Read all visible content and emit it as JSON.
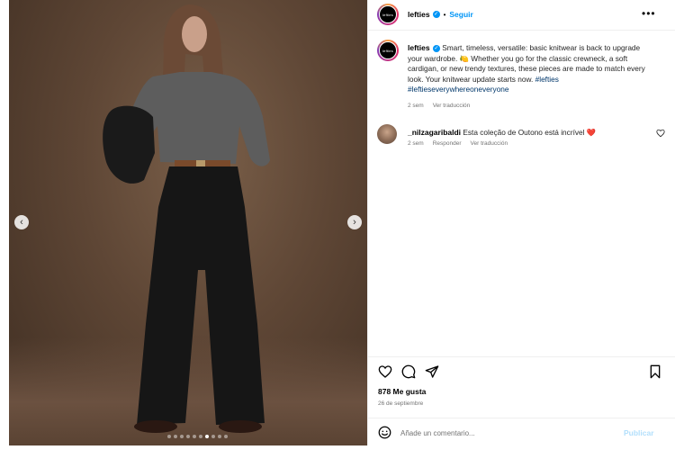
{
  "post": {
    "username": "lefties",
    "follow_label": "Seguir",
    "separator": "•",
    "avatar_text": "lefties"
  },
  "caption": {
    "username": "lefties",
    "text": "Smart, timeless, versatile: basic knitwear is back to upgrade your wardrobe. 🍋 Whether you go for the classic crewneck, a soft cardigan, or new trendy textures, these pieces are made to match every look. Your knitwear update starts now.",
    "hashtags": "#lefties #leftieseverywhereoneveryone",
    "time": "2 sem",
    "translate_label": "Ver traducción"
  },
  "comments": [
    {
      "username": "_nilzagaribaldi",
      "text": "Esta coleção de Outono está incrível",
      "emoji": "❤️",
      "time": "2 sem",
      "reply_label": "Responder",
      "translate_label": "Ver traducción"
    }
  ],
  "carousel": {
    "dot_count": 10,
    "active_dot": 6
  },
  "engagement": {
    "likes": "878 Me gusta",
    "date": "26 de septiembre"
  },
  "composer": {
    "placeholder": "Añade un comentario...",
    "publish_label": "Publicar"
  },
  "icons": [
    "chevron-left-icon",
    "chevron-right-icon",
    "verified-icon",
    "more-icon",
    "heart-icon",
    "comment-icon",
    "share-icon",
    "bookmark-icon",
    "emoji-icon"
  ],
  "colors": {
    "accent": "#0095f6",
    "hashtag": "#00376b",
    "muted": "#737373",
    "heart": "#ed4956",
    "publish_disabled": "#b2dffc"
  }
}
